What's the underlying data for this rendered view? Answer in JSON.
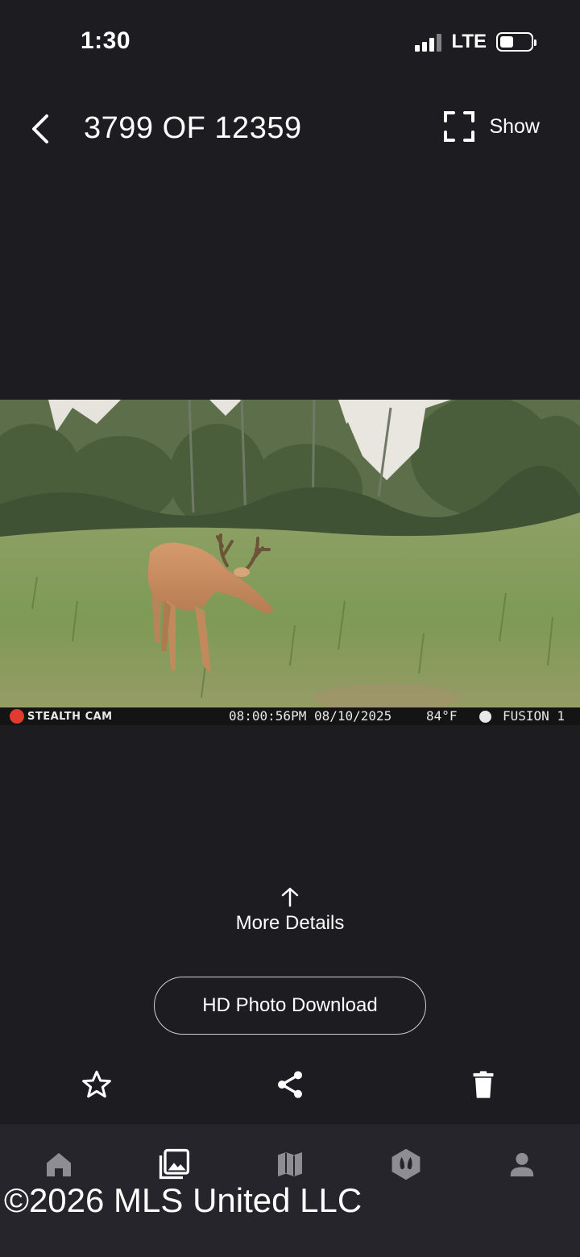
{
  "status_bar": {
    "time": "1:30",
    "network": "LTE",
    "battery_icon": "battery-icon",
    "signal_icon": "signal-icon"
  },
  "header": {
    "back_icon": "chevron-left-icon",
    "counter": "3799 OF 12359",
    "show_label": "Show",
    "fullscreen_icon": "fullscreen-icon"
  },
  "photo": {
    "brand": "STEALTH CAM",
    "timestamp": "08:00:56PM 08/10/2025",
    "temperature": "84°F",
    "camera_name": "FUSION 1"
  },
  "more_details": {
    "label": "More Details",
    "icon": "arrow-up-icon"
  },
  "hd_download": {
    "label": "HD Photo Download"
  },
  "actions": [
    {
      "name": "favorite",
      "icon": "star-icon"
    },
    {
      "name": "share",
      "icon": "share-icon"
    },
    {
      "name": "delete",
      "icon": "trash-icon"
    }
  ],
  "bottom_nav": [
    {
      "name": "home",
      "icon": "home-icon"
    },
    {
      "name": "gallery",
      "icon": "gallery-icon"
    },
    {
      "name": "map",
      "icon": "map-icon"
    },
    {
      "name": "tracks",
      "icon": "deer-track-icon"
    },
    {
      "name": "profile",
      "icon": "person-icon"
    }
  ],
  "watermark": "©2026 MLS United LLC",
  "colors": {
    "background": "#1d1c21",
    "nav_background": "#26252b",
    "text": "#ffffff",
    "icon_muted": "#8e8d93"
  }
}
